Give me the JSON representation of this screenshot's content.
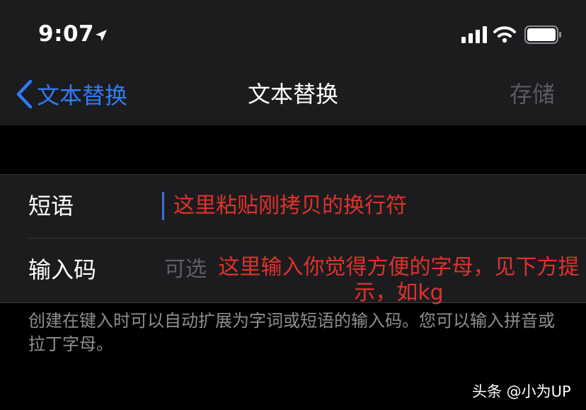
{
  "status_bar": {
    "time": "9:07",
    "icons": [
      "location-arrow-icon",
      "cellular-signal-icon",
      "wifi-icon",
      "battery-icon"
    ]
  },
  "nav": {
    "back_label": "文本替换",
    "title": "文本替换",
    "save_label": "存储"
  },
  "form": {
    "phrase_label": "短语",
    "phrase_annotation": "这里粘贴刚拷贝的换行符",
    "shortcut_label": "输入码",
    "shortcut_placeholder": "可选",
    "shortcut_annotation": "这里输入你觉得方便的字母，见下方提示，如kg"
  },
  "footer_note": "创建在键入时可以自动扩展为字词或短语的输入码。您可以输入拼音或拉丁字母。",
  "watermark": "头条 @小为UP",
  "colors": {
    "accent": "#2f7cf6",
    "annotation": "#e0322b",
    "disabled": "#5b5b5f",
    "cell_background": "#1c1c1e"
  }
}
